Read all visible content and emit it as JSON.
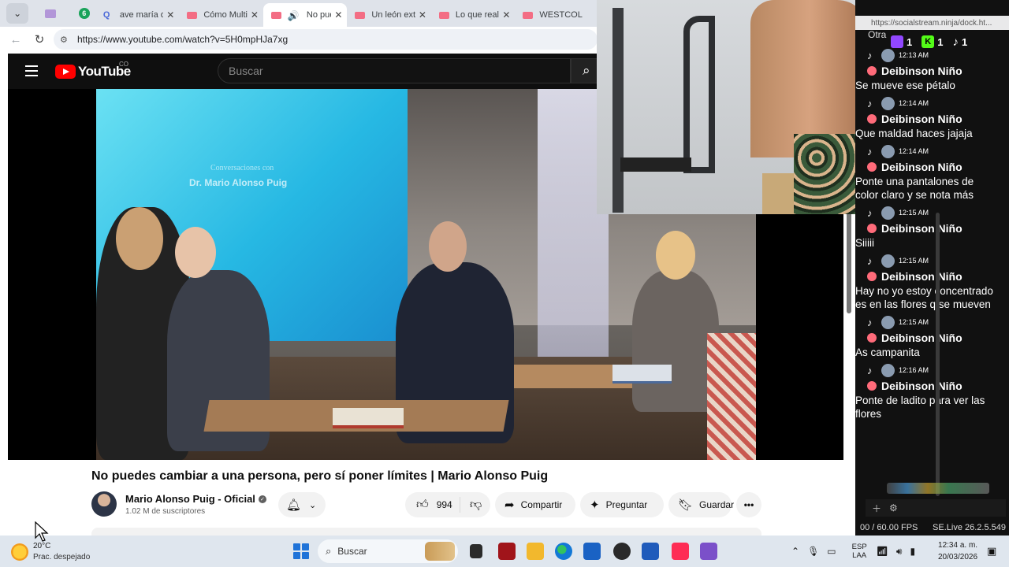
{
  "browser": {
    "tabs": [
      {
        "label": "ave maría orac",
        "icon": "google-search-icon",
        "active": false
      },
      {
        "label": "Cómo Multiplic",
        "icon": "youtube-icon",
        "active": false
      },
      {
        "label": "No pued",
        "icon": "speaker-icon",
        "active": true
      },
      {
        "label": "Un león extrañ",
        "icon": "youtube-icon",
        "active": false
      },
      {
        "label": "Lo que realme",
        "icon": "youtube-icon",
        "active": false
      },
      {
        "label": "WESTCOL",
        "icon": "youtube-icon",
        "active": false
      }
    ],
    "pinned_badge": "6",
    "url": "https://www.youtube.com/watch?v=5H0mpHJa7xg"
  },
  "youtube": {
    "logo_text": "YouTube",
    "country_code": "CO",
    "search_placeholder": "Buscar",
    "video_overlay": {
      "subtitle": "Conversaciones con",
      "title": "Dr. Mario Alonso Puig"
    },
    "video_title": "No puedes cambiar a una persona, pero sí poner límites | Mario Alonso Puig",
    "channel": {
      "name": "Mario Alonso Puig - Oficial",
      "subscribers": "1.02 M de suscriptores"
    },
    "actions": {
      "likes": "994",
      "share": "Compartir",
      "ask": "Preguntar",
      "save": "Guardar"
    }
  },
  "chat": {
    "url": "https://socialstream.ninja/dock.ht...",
    "partial_top": "Otra",
    "counters": [
      {
        "platform": "twitch",
        "count": "1"
      },
      {
        "platform": "kick",
        "count": "1"
      },
      {
        "platform": "tiktok",
        "count": "1"
      }
    ],
    "messages": [
      {
        "time": "12:13 AM",
        "user": "Deibinson Niño",
        "text": "Se mueve ese pétalo"
      },
      {
        "time": "12:14 AM",
        "user": "Deibinson Niño",
        "text": "Que maldad haces jajaja"
      },
      {
        "time": "12:14 AM",
        "user": "Deibinson Niño",
        "text": "Ponte una pantalones de color claro y se nota más"
      },
      {
        "time": "12:15 AM",
        "user": "Deibinson Niño",
        "text": "Siiiii"
      },
      {
        "time": "12:15 AM",
        "user": "Deibinson Niño",
        "text": "Hay no yo estoy concentrado es en las flores q se mueven"
      },
      {
        "time": "12:15 AM",
        "user": "Deibinson Niño",
        "text": "As campanita"
      },
      {
        "time": "12:16 AM",
        "user": "Deibinson Niño",
        "text": "Ponte de ladito para ver las flores"
      }
    ],
    "fps": "00 / 60.00 FPS",
    "version": "SE.Live 26.2.5.549"
  },
  "taskbar": {
    "temperature": "20°C",
    "weather": "Prac. despejado",
    "search_placeholder": "Buscar",
    "lang_top": "ESP",
    "lang_bottom": "LAA",
    "time": "12:34 a. m.",
    "date": "20/03/2026"
  },
  "colors": {
    "youtube_red": "#ff0000",
    "twitch": "#9147ff",
    "kick": "#53fc18",
    "taskbar": "#dfe6ee"
  }
}
